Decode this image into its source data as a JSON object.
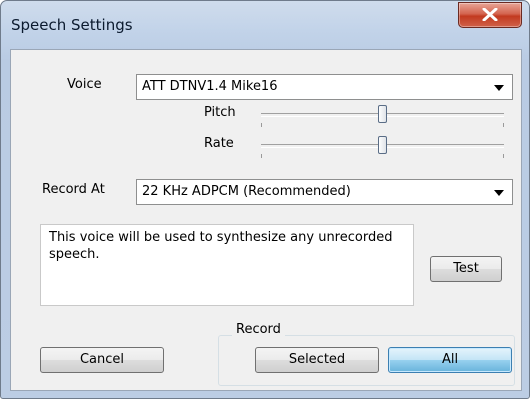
{
  "window": {
    "title": "Speech Settings"
  },
  "voice": {
    "label": "Voice",
    "selected": "ATT DTNV1.4 Mike16"
  },
  "pitch": {
    "label": "Pitch",
    "level": 0.5
  },
  "rate": {
    "label": "Rate",
    "level": 0.5
  },
  "record_at": {
    "label": "Record At",
    "selected": "22 KHz ADPCM (Recommended)"
  },
  "description": {
    "text": "This voice will be used to synthesize any unrecorded speech."
  },
  "buttons": {
    "test": "Test",
    "cancel": "Cancel",
    "selected": "Selected",
    "all": "All"
  },
  "record_group": {
    "label": "Record"
  },
  "icons": {
    "close": "close-x-icon",
    "dropdown": "chevron-down-icon"
  }
}
